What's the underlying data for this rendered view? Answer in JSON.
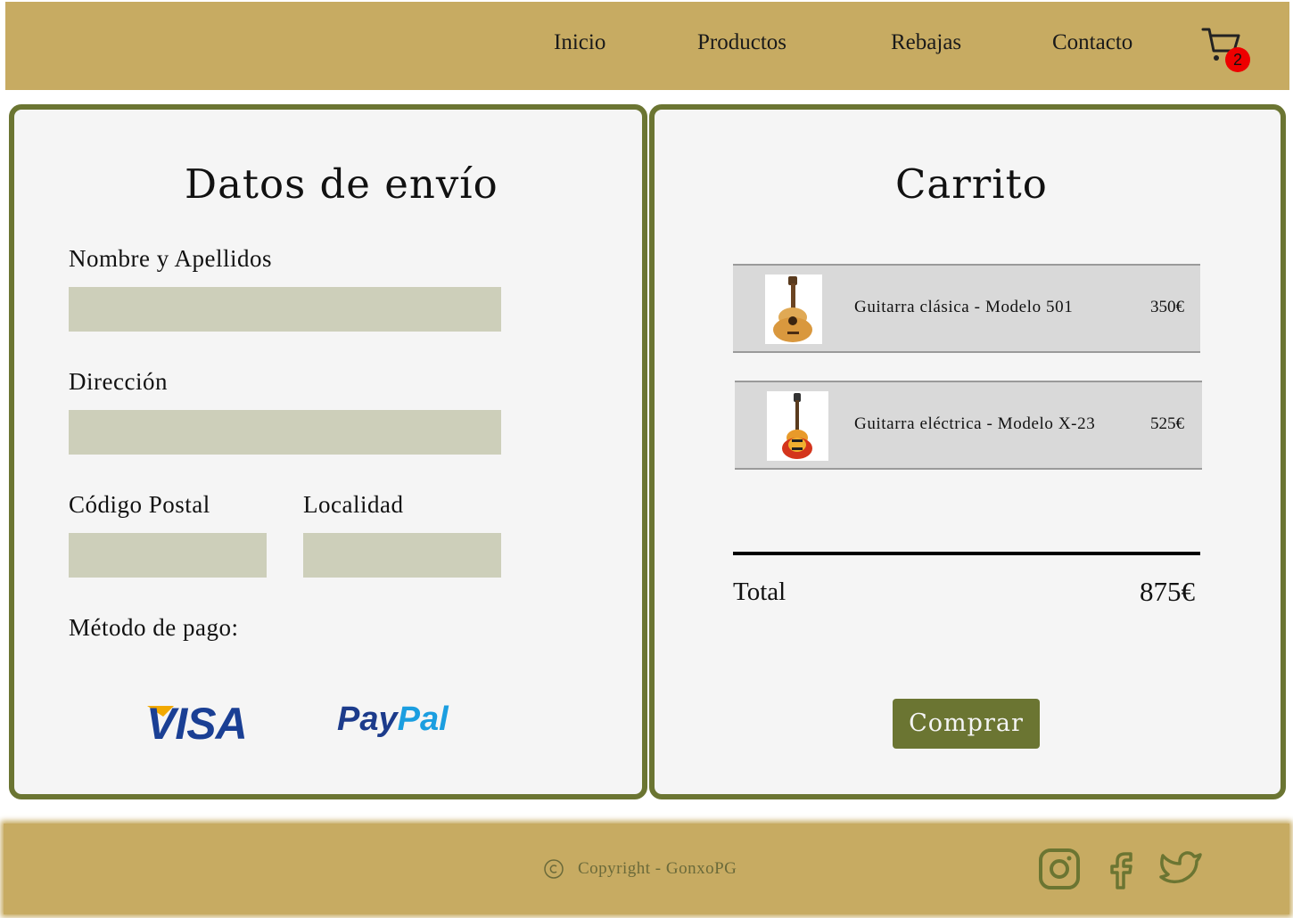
{
  "header": {
    "nav": [
      {
        "label": "Inicio"
      },
      {
        "label": "Productos"
      },
      {
        "label": "Rebajas"
      },
      {
        "label": "Contacto"
      }
    ],
    "cart_icon": "shopping-cart-icon",
    "cart_count": "2"
  },
  "shipping": {
    "title": "Datos de envío",
    "name_label": "Nombre y Apellidos",
    "name_value": "",
    "address_label": "Dirección",
    "address_value": "",
    "postal_label": "Código Postal",
    "postal_value": "",
    "city_label": "Localidad",
    "city_value": "",
    "payment_label": "Método de pago:",
    "payment_options": [
      {
        "name": "VISA"
      },
      {
        "name_part1": "Pay",
        "name_part2": "Pal"
      }
    ]
  },
  "cart": {
    "title": "Carrito",
    "items": [
      {
        "name": "Guitarra clásica - Modelo 501",
        "price": "350€",
        "image": "classical-guitar"
      },
      {
        "name": "Guitarra eléctrica - Modelo X-23",
        "price": "525€",
        "image": "electric-guitar"
      }
    ],
    "total_label": "Total",
    "total_value": "875€",
    "buy_label": "Comprar"
  },
  "footer": {
    "copyright": "Copyright - GonxoPG",
    "social": [
      "instagram-icon",
      "facebook-icon",
      "twitter-icon"
    ]
  },
  "colors": {
    "header_bg": "#c7ab62",
    "accent": "#6b7532",
    "input_bg": "#cdcfba",
    "panel_bg": "#f5f5f5",
    "badge": "#ee0000"
  }
}
